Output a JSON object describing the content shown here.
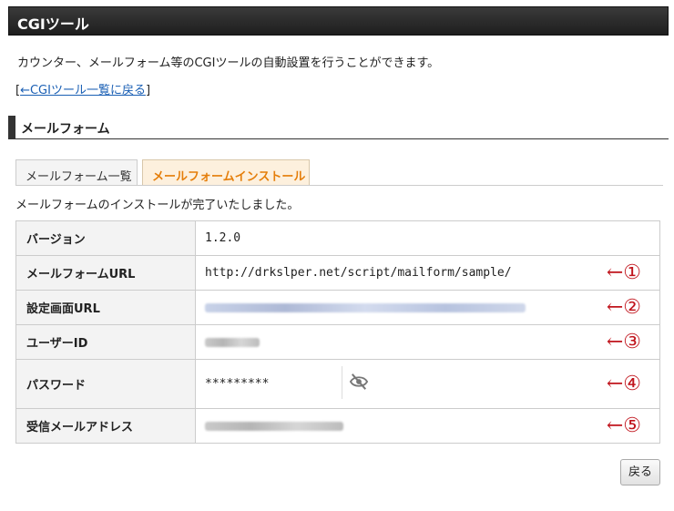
{
  "header": {
    "title": "CGIツール"
  },
  "intro": {
    "description": "カウンター、メールフォーム等のCGIツールの自動設置を行うことができます。",
    "back_link_open": "[",
    "back_link_label": "←CGIツール一覧に戻る",
    "back_link_close": "]"
  },
  "section": {
    "title": "メールフォーム"
  },
  "tabs": [
    {
      "label": "メールフォーム一覧",
      "active": false
    },
    {
      "label": "メールフォームインストール",
      "active": true
    }
  ],
  "status_message": "メールフォームのインストールが完了いたしました。",
  "details": {
    "rows": [
      {
        "key": "バージョン",
        "value": "1.2.0",
        "marker": ""
      },
      {
        "key": "メールフォームURL",
        "value": "http://drkslper.net/script/mailform/sample/",
        "marker": "←①"
      },
      {
        "key": "設定画面URL",
        "value": "",
        "marker": "←②"
      },
      {
        "key": "ユーザーID",
        "value": "",
        "marker": "←③"
      },
      {
        "key": "パスワード",
        "value": "*********",
        "marker": "←④"
      },
      {
        "key": "受信メールアドレス",
        "value": "",
        "marker": "←⑤"
      }
    ],
    "password_toggle_icon": "eye-off-icon",
    "marker_color": "#c0141c"
  },
  "footer": {
    "back_button_label": "戻る"
  },
  "colors": {
    "header_bg": "#262626",
    "active_tab_text": "#e57e0a",
    "link": "#1a5fb4"
  }
}
